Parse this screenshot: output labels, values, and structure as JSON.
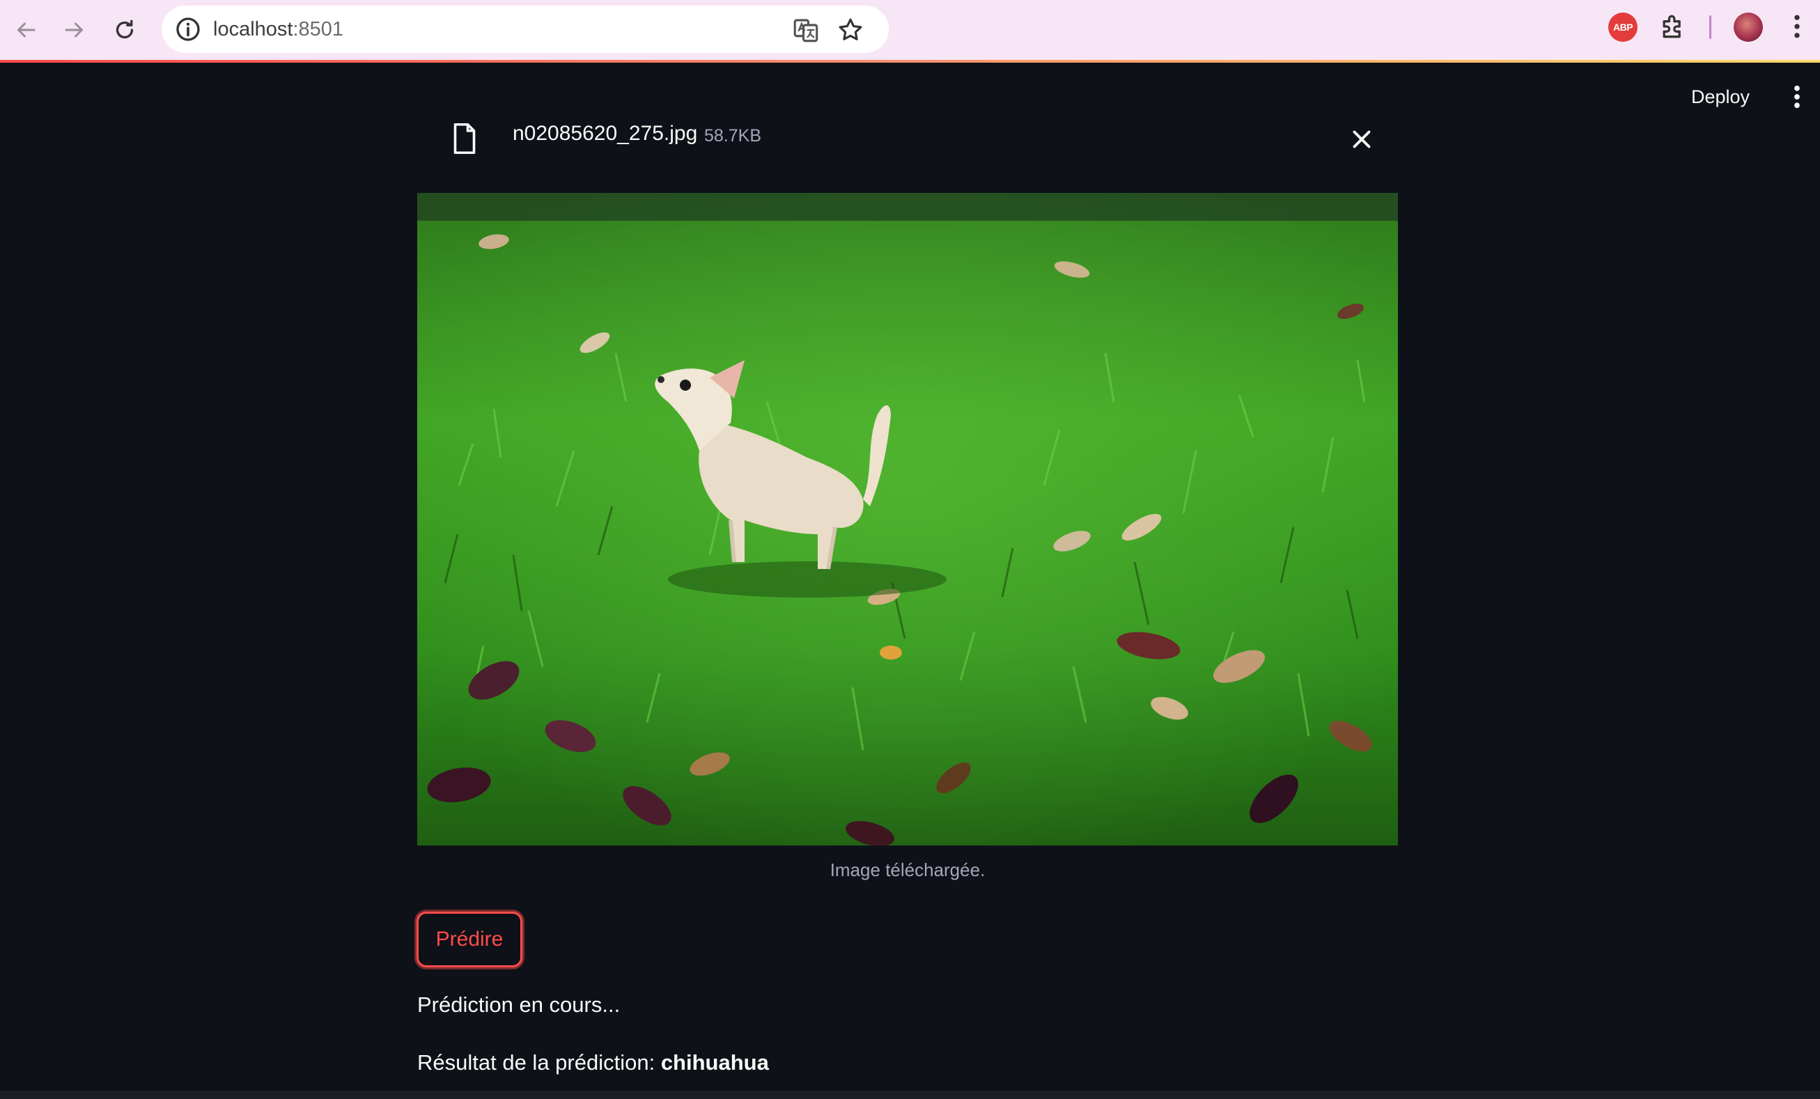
{
  "browser": {
    "url_host": "localhost",
    "url_port": ":8501",
    "extension_label": "ABP"
  },
  "header": {
    "deploy_label": "Deploy"
  },
  "upload": {
    "file_name": "n02085620_275.jpg",
    "file_size": "58.7KB"
  },
  "image": {
    "caption": "Image téléchargée."
  },
  "actions": {
    "predict_label": "Prédire"
  },
  "output": {
    "status": "Prédiction en cours...",
    "result_label": "Résultat de la prédiction: ",
    "result_value": "chihuahua"
  },
  "colors": {
    "background": "#0e1117",
    "accent": "#ff4b4b",
    "chrome": "#f7e6f5"
  }
}
